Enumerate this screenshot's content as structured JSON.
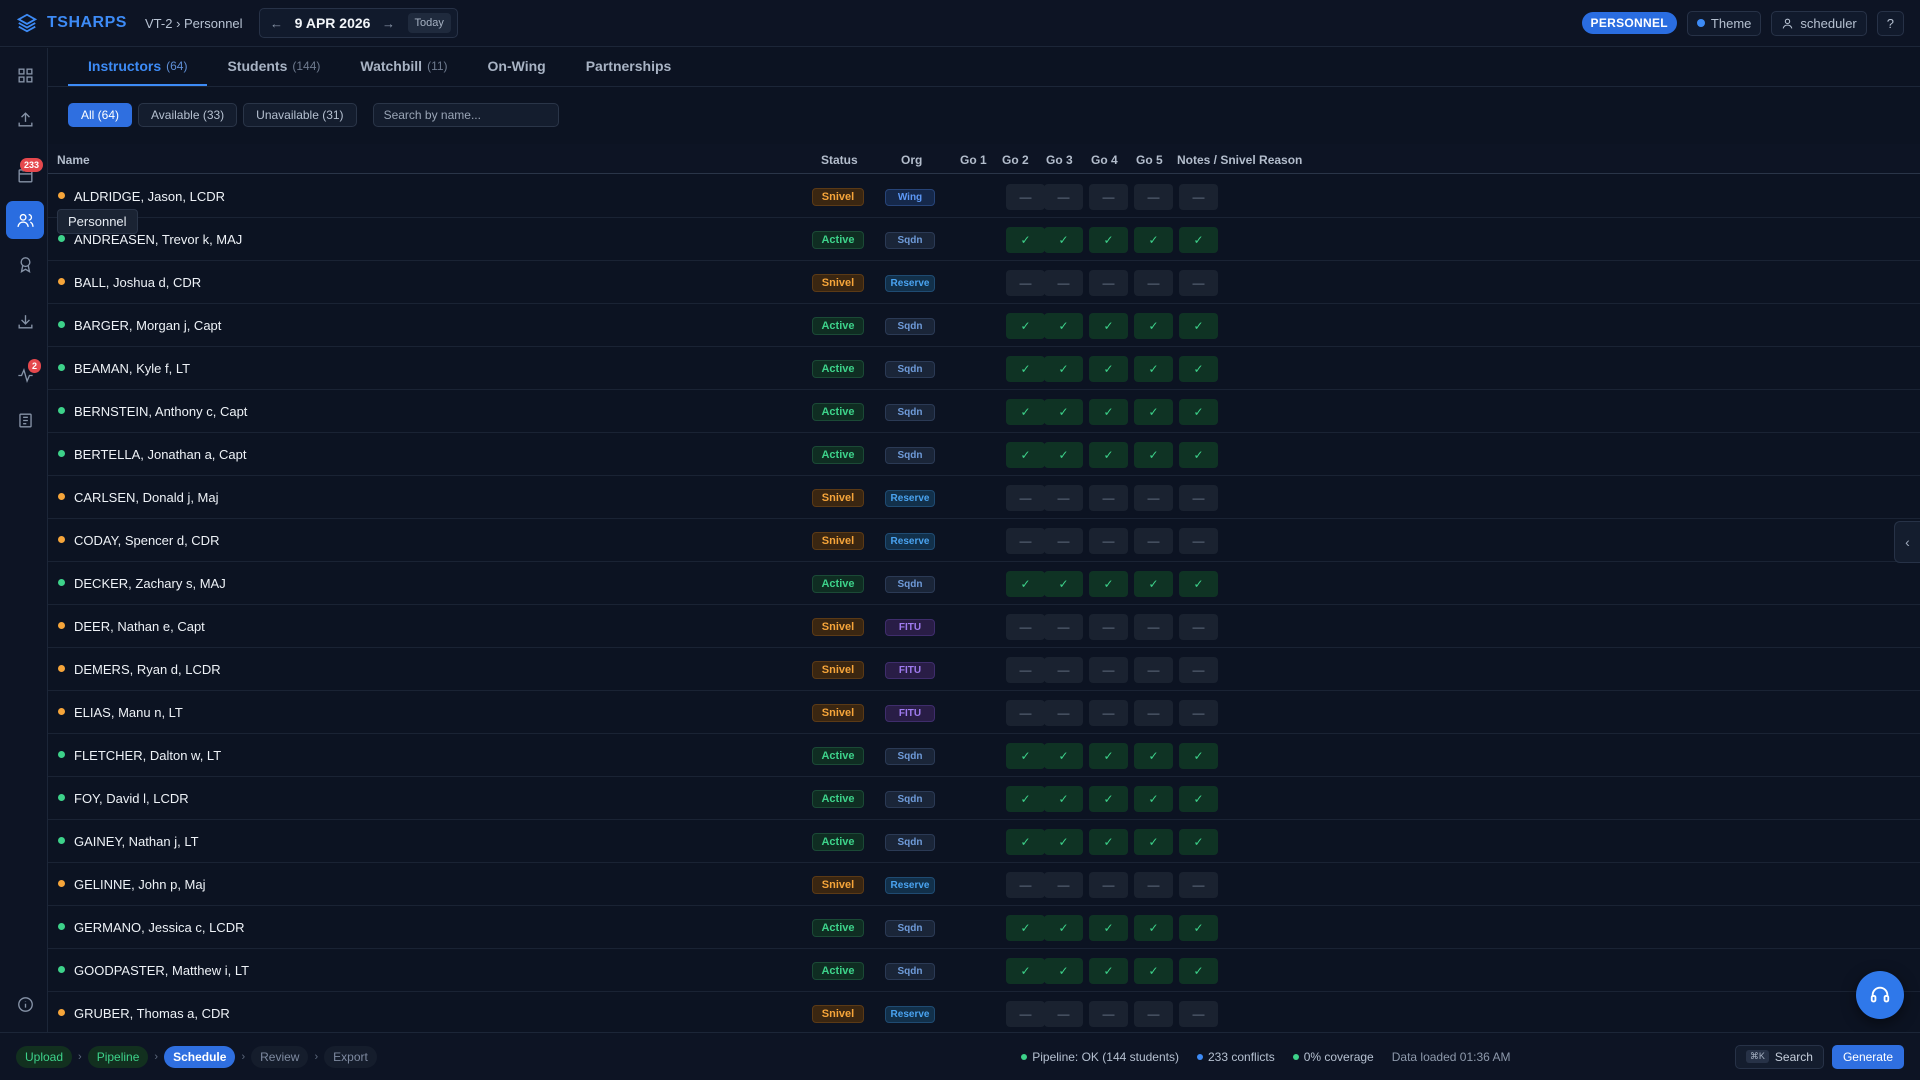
{
  "app": {
    "name": "TSHARPS",
    "breadcrumb": "VT-2 › Personnel"
  },
  "date": {
    "label": "9 APR 2026",
    "prev": "←",
    "next": "→",
    "today": "Today"
  },
  "header": {
    "mode_badge": "PERSONNEL",
    "theme_label": "Theme",
    "user_label": "scheduler",
    "help_label": "?"
  },
  "sidebar": {
    "items": [
      {
        "name": "dashboard",
        "icon": "grid-icon"
      },
      {
        "name": "upload",
        "icon": "upload-icon"
      },
      {
        "name": "schedule",
        "icon": "calendar-icon",
        "badge": "233"
      },
      {
        "name": "personnel",
        "icon": "users-icon",
        "active": true
      },
      {
        "name": "quals",
        "icon": "award-icon"
      },
      {
        "name": "export",
        "icon": "download-icon"
      },
      {
        "name": "pulse",
        "icon": "activity-icon",
        "badge": "2"
      },
      {
        "name": "docs",
        "icon": "book-icon"
      }
    ],
    "tooltip": "Personnel"
  },
  "tabs": [
    {
      "label": "Instructors",
      "count": "(64)",
      "active": true
    },
    {
      "label": "Students",
      "count": "(144)"
    },
    {
      "label": "Watchbill",
      "count": "(11)"
    },
    {
      "label": "On-Wing",
      "count": ""
    },
    {
      "label": "Partnerships",
      "count": ""
    }
  ],
  "filters": {
    "all": "All (64)",
    "available": "Available (33)",
    "unavailable": "Unavailable (31)",
    "search_placeholder": "Search by name..."
  },
  "table": {
    "headers": {
      "name": "Name",
      "status": "Status",
      "org": "Org",
      "go1": "Go 1",
      "go2": "Go 2",
      "go3": "Go 3",
      "go4": "Go 4",
      "go5": "Go 5",
      "notes": "Notes / Snivel Reason"
    },
    "rows": [
      {
        "name": "ALDRIDGE, Jason, LCDR",
        "status": "Snivel",
        "org": "Wing"
      },
      {
        "name": "ANDREASEN, Trevor k, MAJ",
        "status": "Active",
        "org": "Sqdn"
      },
      {
        "name": "BALL, Joshua d, CDR",
        "status": "Snivel",
        "org": "Reserve"
      },
      {
        "name": "BARGER, Morgan j, Capt",
        "status": "Active",
        "org": "Sqdn"
      },
      {
        "name": "BEAMAN, Kyle f, LT",
        "status": "Active",
        "org": "Sqdn"
      },
      {
        "name": "BERNSTEIN, Anthony c, Capt",
        "status": "Active",
        "org": "Sqdn"
      },
      {
        "name": "BERTELLA, Jonathan a, Capt",
        "status": "Active",
        "org": "Sqdn"
      },
      {
        "name": "CARLSEN, Donald j, Maj",
        "status": "Snivel",
        "org": "Reserve"
      },
      {
        "name": "CODAY, Spencer d, CDR",
        "status": "Snivel",
        "org": "Reserve"
      },
      {
        "name": "DECKER, Zachary s, MAJ",
        "status": "Active",
        "org": "Sqdn"
      },
      {
        "name": "DEER, Nathan e, Capt",
        "status": "Snivel",
        "org": "FITU"
      },
      {
        "name": "DEMERS, Ryan d, LCDR",
        "status": "Snivel",
        "org": "FITU"
      },
      {
        "name": "ELIAS, Manu n, LT",
        "status": "Snivel",
        "org": "FITU"
      },
      {
        "name": "FLETCHER, Dalton w, LT",
        "status": "Active",
        "org": "Sqdn"
      },
      {
        "name": "FOY, David l, LCDR",
        "status": "Active",
        "org": "Sqdn"
      },
      {
        "name": "GAINEY, Nathan j, LT",
        "status": "Active",
        "org": "Sqdn"
      },
      {
        "name": "GELINNE, John p, Maj",
        "status": "Snivel",
        "org": "Reserve"
      },
      {
        "name": "GERMANO, Jessica c, LCDR",
        "status": "Active",
        "org": "Sqdn"
      },
      {
        "name": "GOODPASTER, Matthew i, LT",
        "status": "Active",
        "org": "Sqdn"
      },
      {
        "name": "GRUBER, Thomas a, CDR",
        "status": "Snivel",
        "org": "Reserve"
      }
    ],
    "ok_glyph": "✓",
    "no_glyph": "—"
  },
  "footer": {
    "steps": [
      {
        "label": "Upload",
        "state": "done"
      },
      {
        "label": "Pipeline",
        "state": "done"
      },
      {
        "label": "Schedule",
        "state": "cur"
      },
      {
        "label": "Review",
        "state": "todo"
      },
      {
        "label": "Export",
        "state": "todo"
      }
    ],
    "status": [
      {
        "text": "Pipeline: OK (144 students)",
        "color": "#3dd28a"
      },
      {
        "text": "233 conflicts",
        "color": "#3d8bf6"
      },
      {
        "text": "0% coverage",
        "color": "#3dd28a"
      },
      {
        "text": "Data loaded 01:36 AM",
        "color": ""
      }
    ],
    "search_key": "⌘K",
    "search_label": "Search",
    "generate_label": "Generate"
  },
  "colors": {
    "accent": "#2f6fe0",
    "snivel_dot": "#f6a53a",
    "active_dot": "#3dd28a"
  }
}
